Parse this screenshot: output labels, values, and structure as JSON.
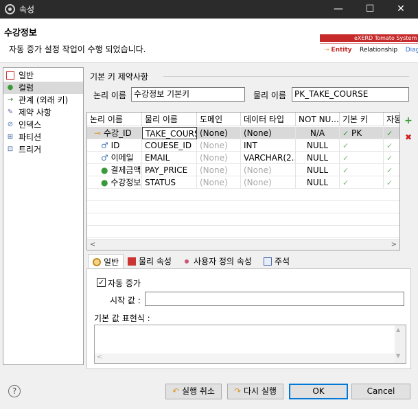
{
  "window": {
    "title": "속성",
    "minimize": "—",
    "maximize": "☐",
    "close": "✕"
  },
  "header": {
    "title": "수강정보",
    "message": "자동 증가 설정 작업이 수행 되었습니다.",
    "banner_brand": "eXERD  Tomato System",
    "banner_tab_entity": "Entity",
    "banner_tab_relationship": "Relationship",
    "banner_tab_diag": "Diag"
  },
  "sidebar": {
    "items": [
      {
        "label": "일반",
        "icon": "table-icon"
      },
      {
        "label": "컬럼",
        "icon": "column-icon"
      },
      {
        "label": "관계 (외래 키)",
        "icon": "relation-arrow-icon"
      },
      {
        "label": "제약 사항",
        "icon": "constraint-icon"
      },
      {
        "label": "인덱스",
        "icon": "index-icon"
      },
      {
        "label": "파티션",
        "icon": "partition-icon"
      },
      {
        "label": "트리거",
        "icon": "trigger-icon"
      }
    ]
  },
  "pk": {
    "group_label": "기본 키 제약사항",
    "logical_label": "논리 이름",
    "logical_value": "수강정보 기본키",
    "physical_label": "물리 이름",
    "physical_value": "PK_TAKE_COURSE"
  },
  "grid": {
    "headers": [
      "논리 이름",
      "물리 이름",
      "도메인",
      "데이터 타입",
      "NOT NU...",
      "기본 키",
      "자동"
    ],
    "rows": [
      {
        "logical": "수강_ID",
        "physical": "TAKE_COURSE",
        "domain": "(None)",
        "type": "(None)",
        "notnull": "N/A",
        "pk": "PK",
        "pk_check": "✓",
        "auto": "✓",
        "selected": true
      },
      {
        "logical": "ID",
        "physical": "COUESE_ID",
        "domain": "(None)",
        "type": "INT",
        "notnull": "NULL",
        "pk": "",
        "pk_check": "✓",
        "auto": "✓",
        "selected": false
      },
      {
        "logical": "이메일",
        "physical": "EMAIL",
        "domain": "(None)",
        "type": "VARCHAR(2...",
        "notnull": "NULL",
        "pk": "",
        "pk_check": "✓",
        "auto": "✓",
        "selected": false
      },
      {
        "logical": "결제금액",
        "physical": "PAY_PRICE",
        "domain": "(None)",
        "type": "(None)",
        "notnull": "NULL",
        "pk": "",
        "pk_check": "✓",
        "auto": "✓",
        "selected": false
      },
      {
        "logical": "수강정보",
        "physical": "STATUS",
        "domain": "(None)",
        "type": "(None)",
        "notnull": "NULL",
        "pk": "",
        "pk_check": "✓",
        "auto": "✓",
        "selected": false
      }
    ],
    "add_glyph": "+",
    "delete_glyph": "✖",
    "scroll_left": "<",
    "scroll_right": ">"
  },
  "tabs": [
    {
      "label": "일반",
      "icon": "general-icon"
    },
    {
      "label": "물리 속성",
      "icon": "physical-icon"
    },
    {
      "label": "사용자 정의 속성",
      "icon": "user-attr-icon"
    },
    {
      "label": "주석",
      "icon": "comment-icon"
    }
  ],
  "general": {
    "auto_increment_label": "자동 증가",
    "auto_increment_checked": "✓",
    "start_label": "시작 값 :",
    "start_value": "",
    "default_label": "기본 값 표현식 :",
    "scroll_up": "▲",
    "scroll_down": "▼"
  },
  "footer": {
    "help": "?",
    "undo": "실행 취소",
    "redo": "다시 실행",
    "ok": "OK",
    "cancel": "Cancel"
  },
  "colors": {
    "accent": "#0078d7",
    "titlebar": "#2b2b2b",
    "brand_red": "#c62a2a",
    "check_green": "#7cb87c"
  }
}
